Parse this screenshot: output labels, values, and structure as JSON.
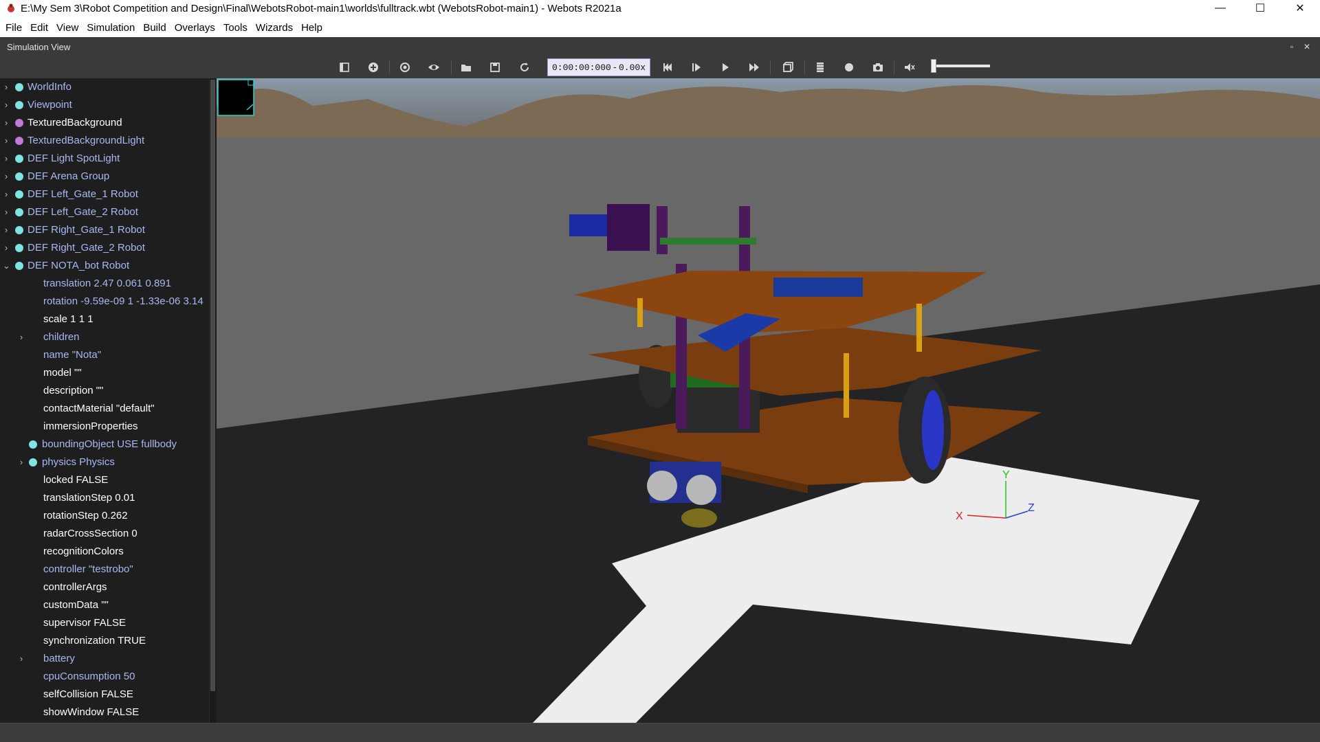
{
  "window": {
    "title": "E:\\My Sem 3\\Robot Competition and Design\\Final\\WebotsRobot-main1\\worlds\\fulltrack.wbt (WebotsRobot-main1) - Webots R2021a",
    "minimize": "—",
    "maximize": "☐",
    "close": "✕"
  },
  "menu": [
    "File",
    "Edit",
    "View",
    "Simulation",
    "Build",
    "Overlays",
    "Tools",
    "Wizards",
    "Help"
  ],
  "dock": {
    "title": "Simulation View",
    "float": "▫",
    "close": "✕"
  },
  "toolbar": {
    "time": "0:00:00:000",
    "dash": "-",
    "speed": "0.00x",
    "volume_level": 0.0
  },
  "tree": [
    {
      "arrow": "›",
      "dot": "#7fe3e3",
      "label": "WorldInfo",
      "indent": 0,
      "style": "node"
    },
    {
      "arrow": "›",
      "dot": "#7fe3e3",
      "label": "Viewpoint",
      "indent": 0,
      "style": "node"
    },
    {
      "arrow": "›",
      "dot": "#c07ad8",
      "label": "TexturedBackground",
      "indent": 0,
      "style": "def"
    },
    {
      "arrow": "›",
      "dot": "#c07ad8",
      "label": "TexturedBackgroundLight",
      "indent": 0,
      "style": "node"
    },
    {
      "arrow": "›",
      "dot": "#7fe3e3",
      "label": "DEF Light SpotLight",
      "indent": 0,
      "style": "node"
    },
    {
      "arrow": "›",
      "dot": "#7fe3e3",
      "label": "DEF Arena Group",
      "indent": 0,
      "style": "node"
    },
    {
      "arrow": "›",
      "dot": "#7fe3e3",
      "label": "DEF Left_Gate_1 Robot",
      "indent": 0,
      "style": "node"
    },
    {
      "arrow": "›",
      "dot": "#7fe3e3",
      "label": "DEF Left_Gate_2 Robot",
      "indent": 0,
      "style": "node"
    },
    {
      "arrow": "›",
      "dot": "#7fe3e3",
      "label": "DEF Right_Gate_1 Robot",
      "indent": 0,
      "style": "node"
    },
    {
      "arrow": "›",
      "dot": "#7fe3e3",
      "label": "DEF Right_Gate_2 Robot",
      "indent": 0,
      "style": "node"
    },
    {
      "arrow": "⌄",
      "dot": "#7fe3e3",
      "label": "DEF NOTA_bot Robot",
      "indent": 0,
      "style": "node"
    },
    {
      "arrow": "",
      "dot": "",
      "label": "translation 2.47 0.061 0.891",
      "indent": 1,
      "style": "mod"
    },
    {
      "arrow": "",
      "dot": "",
      "label": "rotation -9.59e-09 1 -1.33e-06 3.14",
      "indent": 1,
      "style": "mod"
    },
    {
      "arrow": "",
      "dot": "",
      "label": "scale 1 1 1",
      "indent": 1,
      "style": "field"
    },
    {
      "arrow": "›",
      "dot": "",
      "label": "children",
      "indent": 1,
      "style": "mod"
    },
    {
      "arrow": "",
      "dot": "",
      "label": "name \"Nota\"",
      "indent": 1,
      "style": "mod"
    },
    {
      "arrow": "",
      "dot": "",
      "label": "model \"\"",
      "indent": 1,
      "style": "field"
    },
    {
      "arrow": "",
      "dot": "",
      "label": "description \"\"",
      "indent": 1,
      "style": "field"
    },
    {
      "arrow": "",
      "dot": "",
      "label": "contactMaterial \"default\"",
      "indent": 1,
      "style": "field"
    },
    {
      "arrow": "",
      "dot": "",
      "label": "immersionProperties",
      "indent": 1,
      "style": "field"
    },
    {
      "arrow": "",
      "dot": "#7fe3e3",
      "label": "boundingObject USE fullbody",
      "indent": 1,
      "style": "mod"
    },
    {
      "arrow": "›",
      "dot": "#7fe3e3",
      "label": "physics Physics",
      "indent": 1,
      "style": "mod"
    },
    {
      "arrow": "",
      "dot": "",
      "label": "locked FALSE",
      "indent": 1,
      "style": "field"
    },
    {
      "arrow": "",
      "dot": "",
      "label": "translationStep 0.01",
      "indent": 1,
      "style": "field"
    },
    {
      "arrow": "",
      "dot": "",
      "label": "rotationStep 0.262",
      "indent": 1,
      "style": "field"
    },
    {
      "arrow": "",
      "dot": "",
      "label": "radarCrossSection 0",
      "indent": 1,
      "style": "field"
    },
    {
      "arrow": "",
      "dot": "",
      "label": "recognitionColors",
      "indent": 1,
      "style": "field"
    },
    {
      "arrow": "",
      "dot": "",
      "label": "controller \"testrobo\"",
      "indent": 1,
      "style": "mod"
    },
    {
      "arrow": "",
      "dot": "",
      "label": "controllerArgs",
      "indent": 1,
      "style": "field"
    },
    {
      "arrow": "",
      "dot": "",
      "label": "customData \"\"",
      "indent": 1,
      "style": "field"
    },
    {
      "arrow": "",
      "dot": "",
      "label": "supervisor FALSE",
      "indent": 1,
      "style": "field"
    },
    {
      "arrow": "",
      "dot": "",
      "label": "synchronization TRUE",
      "indent": 1,
      "style": "field"
    },
    {
      "arrow": "›",
      "dot": "",
      "label": "battery",
      "indent": 1,
      "style": "mod"
    },
    {
      "arrow": "",
      "dot": "",
      "label": "cpuConsumption 50",
      "indent": 1,
      "style": "mod"
    },
    {
      "arrow": "",
      "dot": "",
      "label": "selfCollision FALSE",
      "indent": 1,
      "style": "field"
    },
    {
      "arrow": "",
      "dot": "",
      "label": "showWindow FALSE",
      "indent": 1,
      "style": "field"
    }
  ],
  "axes": {
    "x": "X",
    "y": "Y",
    "z": "Z"
  },
  "colors": {
    "accent_time_box": "#e9e7f5",
    "node_text": "#a9b8f2",
    "proto_dot": "#7fe3e3",
    "base_node_dot": "#c07ad8",
    "axis_x": "#e02020",
    "axis_y": "#20c020",
    "axis_z": "#2040e0"
  }
}
